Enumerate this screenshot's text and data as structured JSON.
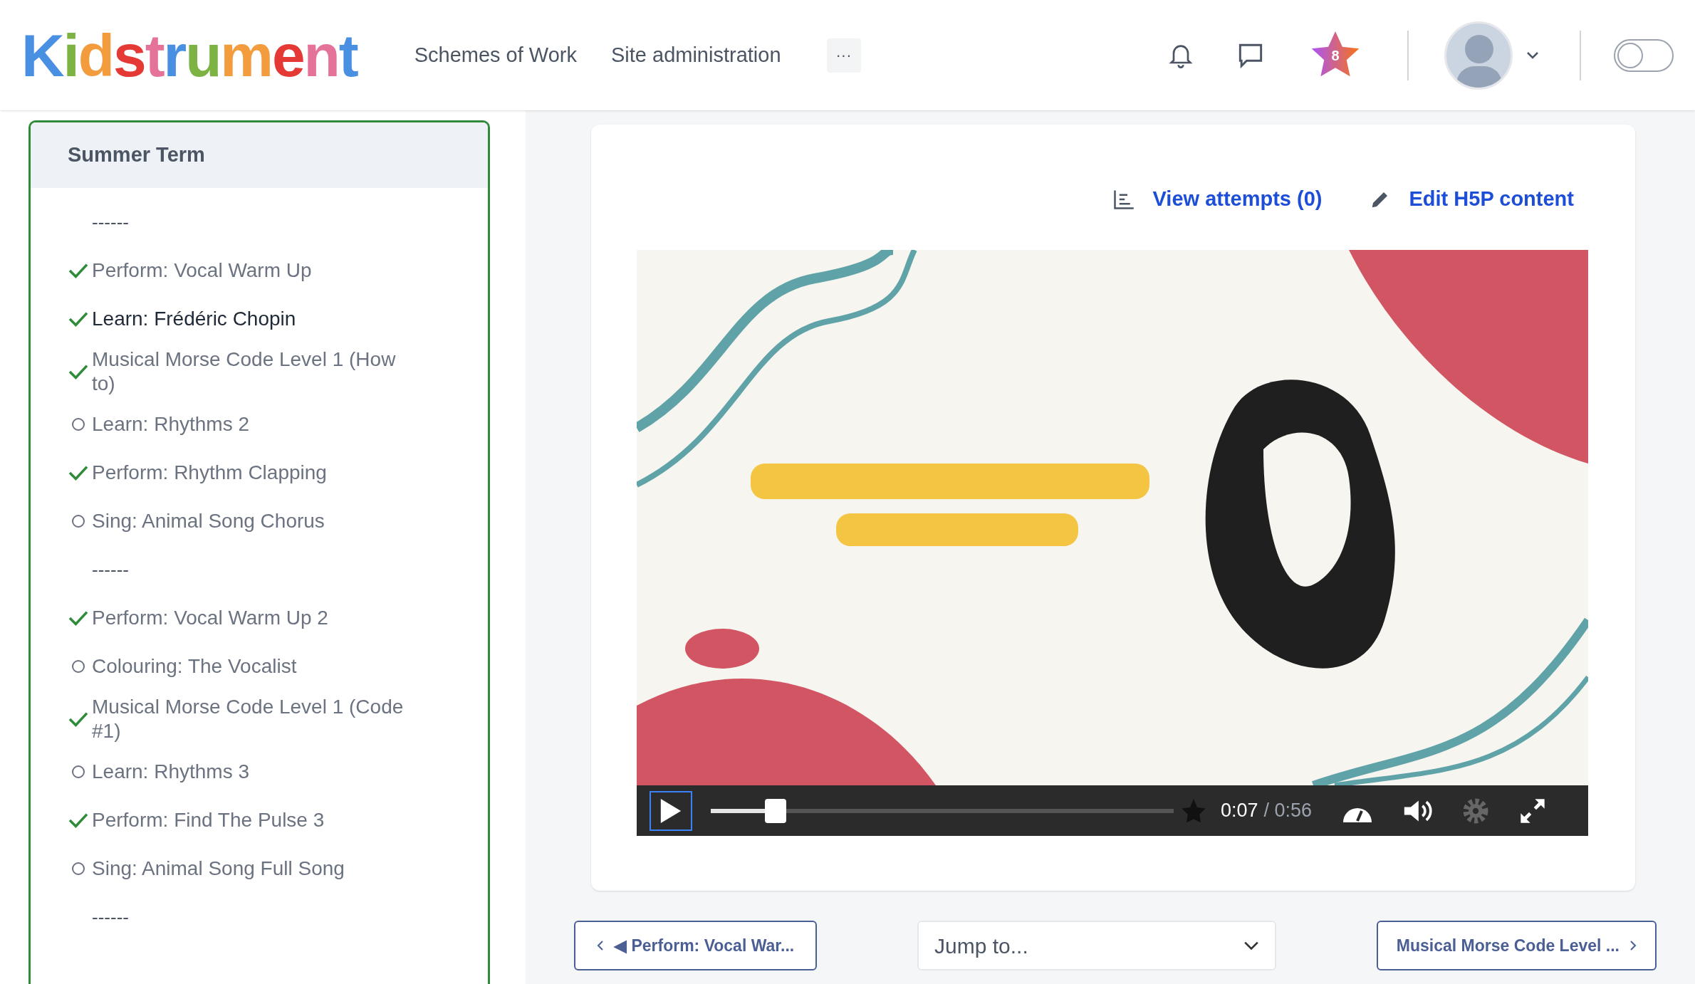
{
  "header": {
    "logo": "Kidstrument",
    "nav": [
      {
        "label": "Schemes of Work"
      },
      {
        "label": "Site administration"
      }
    ],
    "more": "···",
    "badge": "8",
    "dark_mode": false
  },
  "sidebar": {
    "section": "Summer Term",
    "items": [
      {
        "kind": "separator",
        "label": "------"
      },
      {
        "kind": "activity",
        "label": "Perform: Vocal Warm Up",
        "done": true,
        "selected": false
      },
      {
        "kind": "activity",
        "label": "Learn: Frédéric Chopin",
        "done": true,
        "selected": true
      },
      {
        "kind": "activity",
        "label": "Musical Morse Code Level 1 (How to)",
        "done": true,
        "selected": false
      },
      {
        "kind": "activity",
        "label": "Learn: Rhythms 2",
        "done": false,
        "selected": false
      },
      {
        "kind": "activity",
        "label": "Perform: Rhythm Clapping",
        "done": true,
        "selected": false
      },
      {
        "kind": "activity",
        "label": "Sing: Animal Song Chorus",
        "done": false,
        "selected": false
      },
      {
        "kind": "separator",
        "label": "------"
      },
      {
        "kind": "activity",
        "label": "Perform: Vocal Warm Up 2",
        "done": true,
        "selected": false
      },
      {
        "kind": "activity",
        "label": "Colouring: The Vocalist",
        "done": false,
        "selected": false
      },
      {
        "kind": "activity",
        "label": "Musical Morse Code Level 1 (Code #1)",
        "done": true,
        "selected": false
      },
      {
        "kind": "activity",
        "label": "Learn: Rhythms 3",
        "done": false,
        "selected": false
      },
      {
        "kind": "activity",
        "label": "Perform: Find The Pulse 3",
        "done": true,
        "selected": false
      },
      {
        "kind": "activity",
        "label": "Sing: Animal Song Full Song",
        "done": false,
        "selected": false
      },
      {
        "kind": "separator",
        "label": "------"
      }
    ]
  },
  "content": {
    "actions": [
      {
        "kind": "attempts",
        "label": "View attempts (0)"
      },
      {
        "kind": "edit",
        "label": "Edit H5P content"
      }
    ],
    "video": {
      "kind": "picture",
      "playing": false,
      "level": 0.14,
      "time": "0:07",
      "duration": "/ 0:56"
    }
  },
  "footer": {
    "prev": "◀ Perform: Vocal War...",
    "jump": {
      "placeholder": "Jump to..."
    },
    "next": "Musical Morse Code Level ..."
  }
}
